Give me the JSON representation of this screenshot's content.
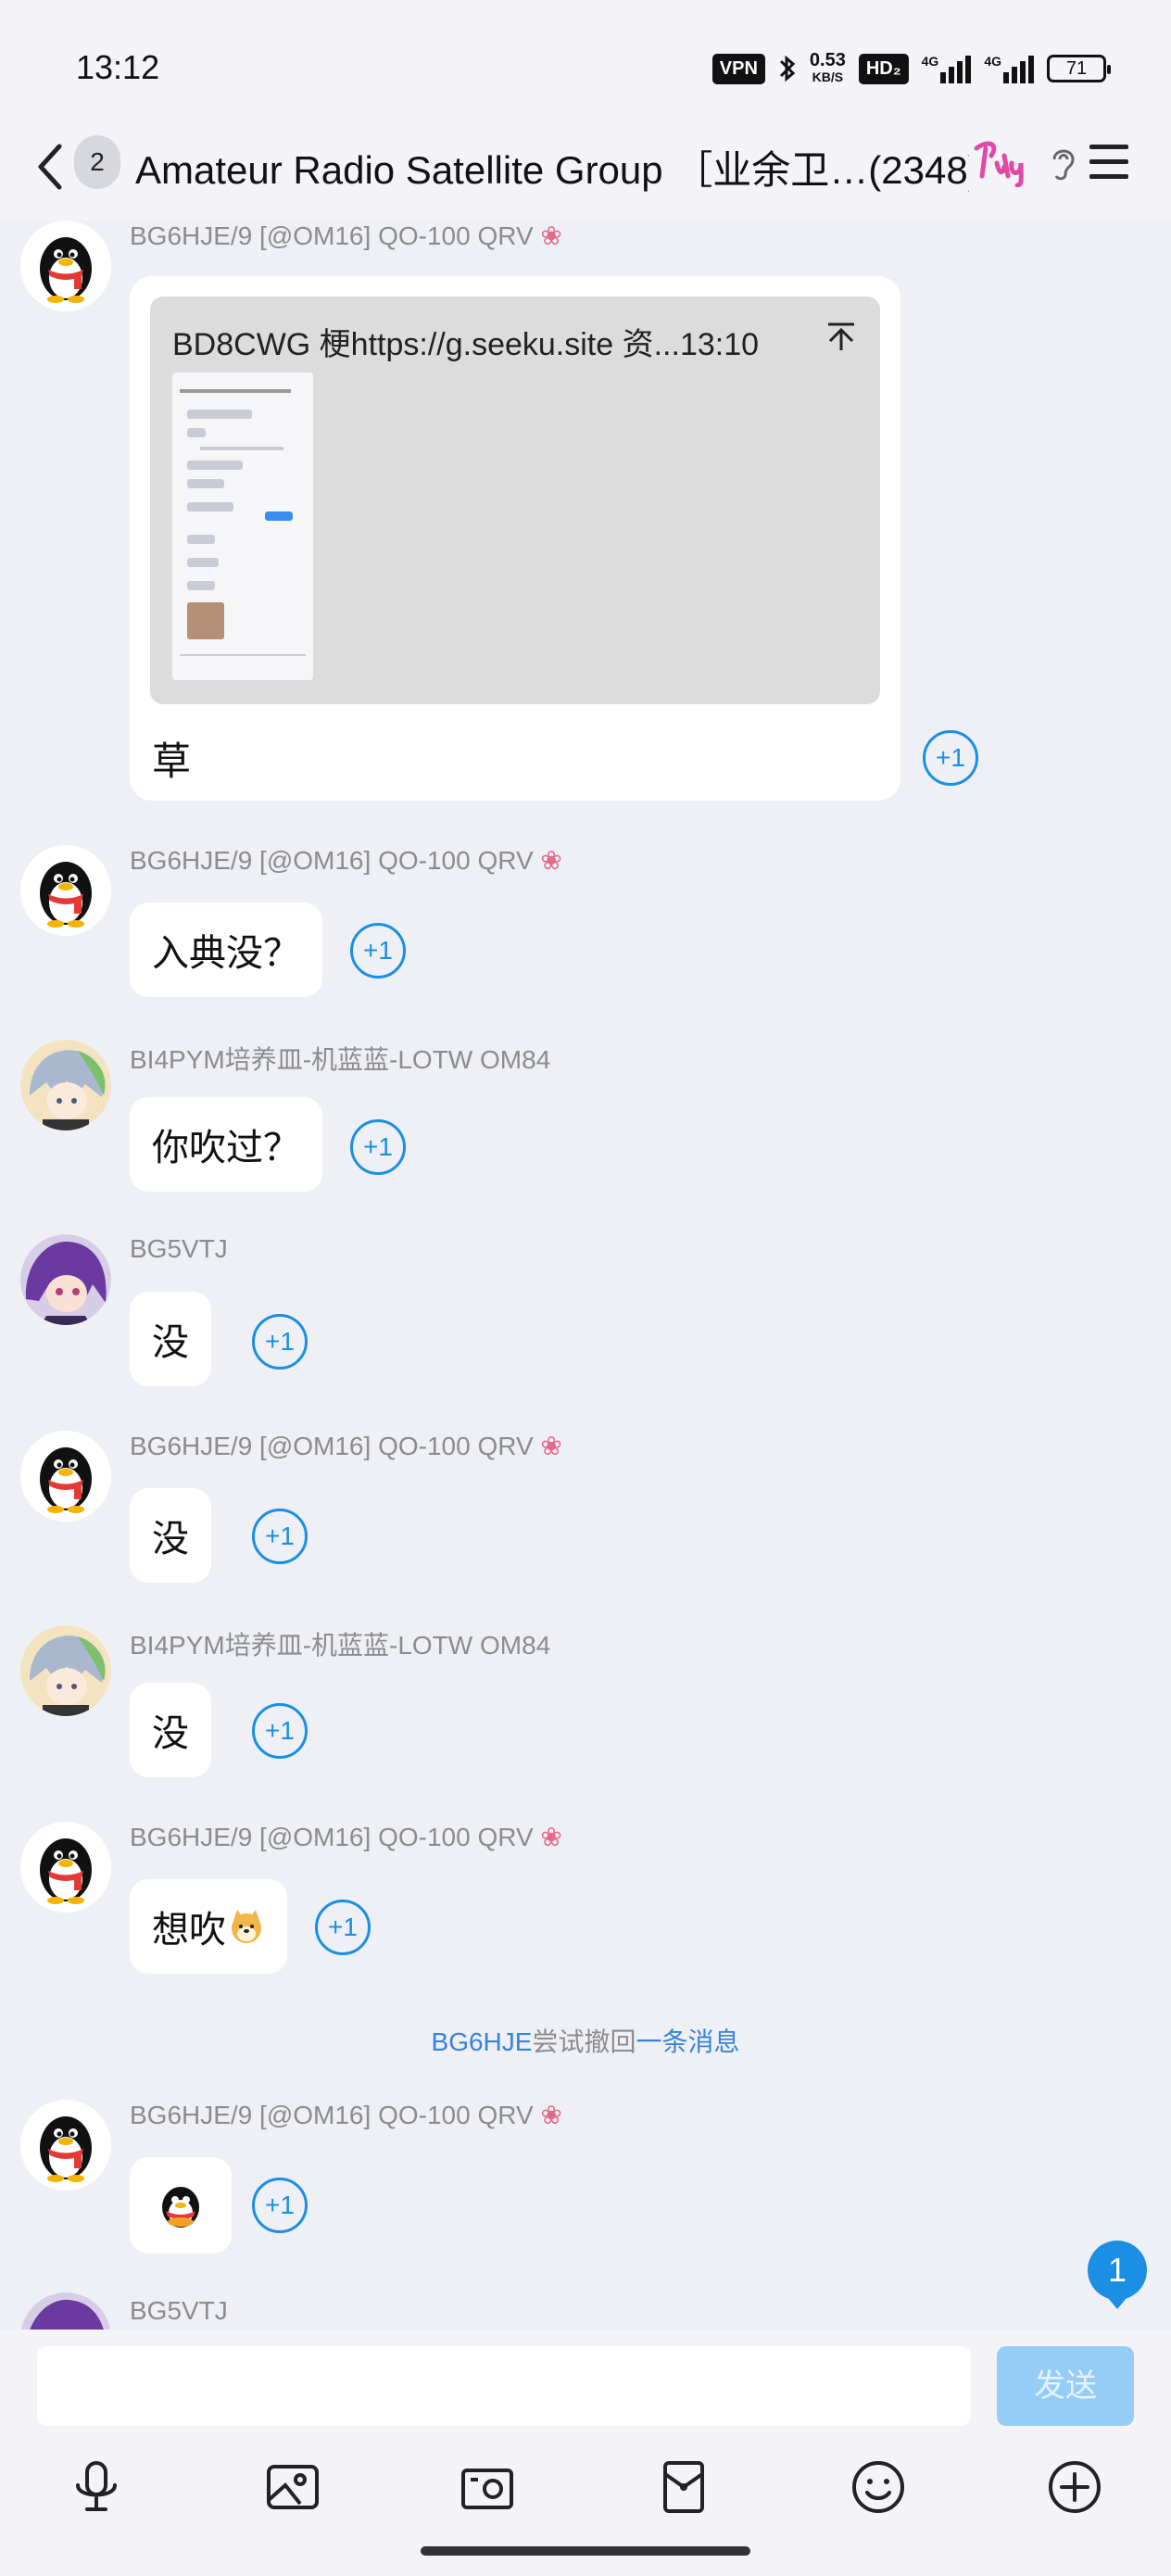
{
  "status_bar": {
    "time": "13:12",
    "vpn": "VPN",
    "speed_value": "0.53",
    "speed_unit": "KB/S",
    "hd": "HD₂",
    "net1": "4G",
    "net2": "4G",
    "battery": "71"
  },
  "header": {
    "back_count": "2",
    "title": "Amateur Radio Satellite Group ［业余卫…(2348)"
  },
  "quote_message": {
    "sender": "BG6HJE/9 [@OM16] QO-100 QRV",
    "quoted_title": "BD8CWG 梗https://g.seeku.site  资...13:10",
    "reply": "草",
    "plus_one": "+1"
  },
  "messages": [
    {
      "sender": "BG6HJE/9 [@OM16] QO-100 QRV",
      "text": "入典没？",
      "plus_one": "+1"
    },
    {
      "sender": "BI4PYM培养皿-机蓝蓝-LOTW OM84",
      "text": "你吹过？",
      "plus_one": "+1"
    },
    {
      "sender": "BG5VTJ",
      "text": "没",
      "plus_one": "+1"
    },
    {
      "sender": "BG6HJE/9 [@OM16] QO-100 QRV",
      "text": "没",
      "plus_one": "+1"
    },
    {
      "sender": "BI4PYM培养皿-机蓝蓝-LOTW OM84",
      "text": "没",
      "plus_one": "+1"
    },
    {
      "sender": "BG6HJE/9 [@OM16] QO-100 QRV",
      "text": "想吹",
      "plus_one": "+1"
    },
    {
      "sender": "BG6HJE/9 [@OM16] QO-100 QRV",
      "text": "",
      "plus_one": "+1"
    },
    {
      "sender": "BG5VTJ"
    }
  ],
  "recall_notice": {
    "user": "BG6HJE",
    "middle": "尝试撤回",
    "link": "一条消息"
  },
  "unread_count": "1",
  "composer": {
    "placeholder": "",
    "send_label": "发送"
  },
  "toolbar_icons": [
    "microphone-icon",
    "image-icon",
    "camera-icon",
    "red-packet-icon",
    "emoji-icon",
    "plus-icon"
  ]
}
